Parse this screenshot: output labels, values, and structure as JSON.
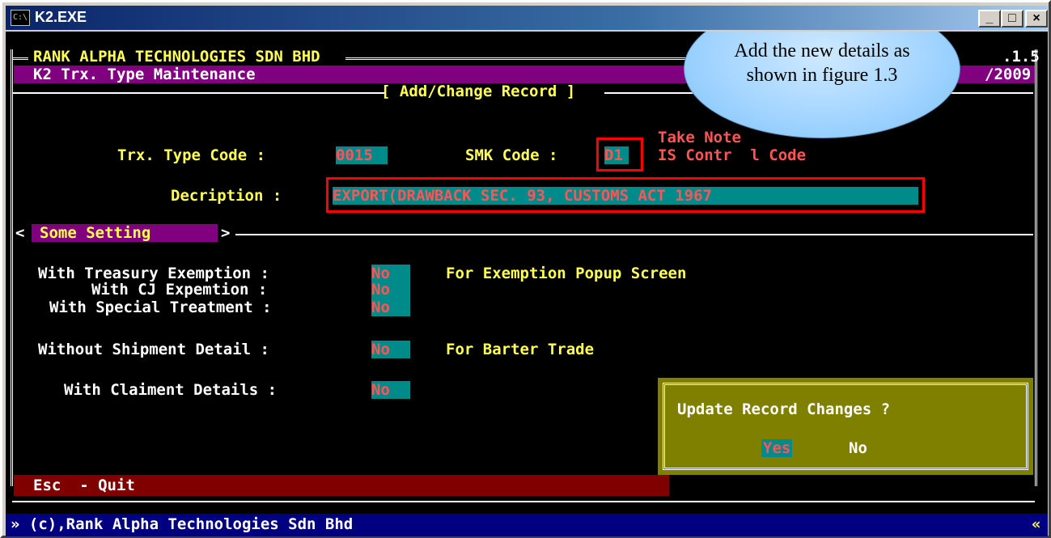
{
  "window": {
    "title": "K2.EXE",
    "sys_icon_text": "C:\\",
    "minimize_glyph": "_",
    "maximize_glyph": "□",
    "close_glyph": "×"
  },
  "header": {
    "company": "RANK ALPHA TECHNOLOGIES SDN BHD",
    "version_fragment": ".1.5",
    "module_title": "K2 Trx. Type Maintenance",
    "date_fragment": "/2009",
    "section_title": "[ Add/Change Record ]"
  },
  "form": {
    "trx_type_label": "Trx. Type Code :",
    "trx_type_value": "0015",
    "smk_label": "SMK Code :",
    "smk_value": "D1",
    "note_line1": "Take Note",
    "note_line2": "IS Contr  l Code",
    "description_label": "Decription :",
    "description_value": "EXPORT(DRAWBACK SEC. 93, CUSTOMS ACT 1967"
  },
  "settings": {
    "section_label": "Some Setting",
    "treasury_label": "With Treasury Exemption :",
    "treasury_value": "No",
    "treasury_hint": "For Exemption Popup Screen",
    "cj_label": "With CJ Expemtion :",
    "cj_value": "No",
    "special_label": "With Special Treatment :",
    "special_value": "No",
    "shipment_label": "Without Shipment Detail :",
    "shipment_value": "No",
    "shipment_hint": "For Barter Trade",
    "claiment_label": "With Claiment Details :",
    "claiment_value": "No"
  },
  "dialog": {
    "question": "Update Record Changes ?",
    "yes_label": "Yes",
    "no_label": "No"
  },
  "footer": {
    "esc_hint": "Esc  - Quit",
    "copyright": "» (c),Rank Alpha Technologies Sdn Bhd",
    "right_marker": "«"
  },
  "callout": {
    "line1": "Add the new details as",
    "line2": "shown in figure 1.3"
  },
  "colors": {
    "console_bg": "#000000",
    "label_yellow": "#ffff55",
    "field_cyan": "#008b8b",
    "field_text_red": "#ff5555",
    "header_purple": "#800080",
    "esc_bar": "#800000",
    "status_bar": "#000080",
    "dialog_olive": "#808000",
    "highlight_box": "#ff0000"
  }
}
